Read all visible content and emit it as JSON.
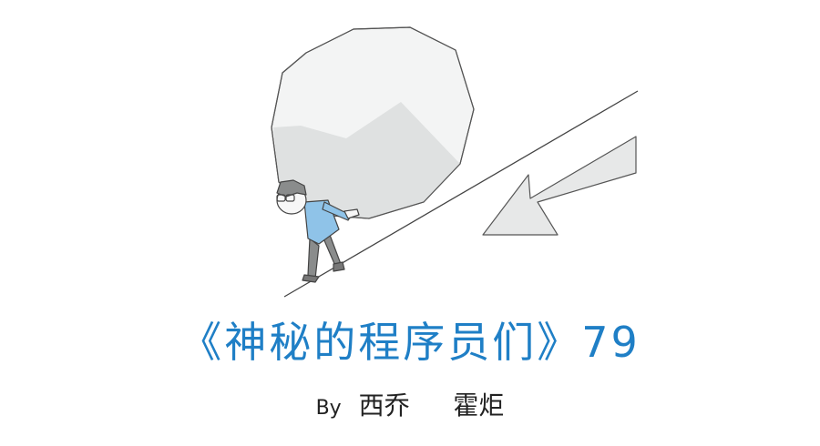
{
  "title": "《神秘的程序员们》79",
  "byline": {
    "by": "By",
    "author1": "西乔",
    "author2": "霍炬"
  },
  "colors": {
    "title": "#1f7fc6",
    "shirt": "#8fc3e8",
    "boulder_shade": "#dfe1e1",
    "arrow": "#e6e7e7"
  }
}
